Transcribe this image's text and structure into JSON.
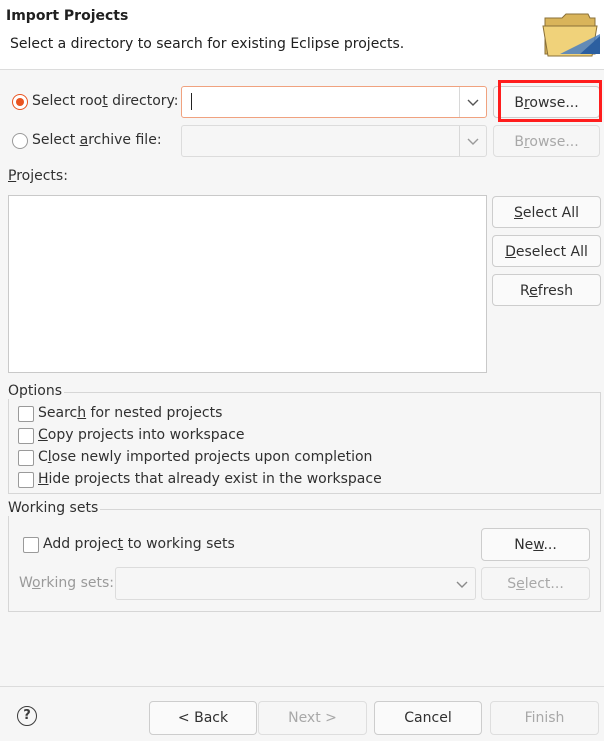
{
  "header": {
    "title": "Import Projects",
    "subtitle": "Select a directory to search for existing Eclipse projects."
  },
  "source": {
    "root_dir_label_pre": "Select roo",
    "root_dir_label_mn": "t",
    "root_dir_label_post": " directory:",
    "root_dir_value": "",
    "archive_label_pre": "Select ",
    "archive_label_mn": "a",
    "archive_label_post": "rchive file:",
    "archive_value": "",
    "browse_pre": "B",
    "browse_mn": "r",
    "browse_post": "owse...",
    "browse2_pre": "B",
    "browse2_mn": "r",
    "browse2_post": "owse..."
  },
  "projects": {
    "label_mn": "P",
    "label_post": "rojects:",
    "items": [],
    "select_all_mn": "S",
    "select_all_post": "elect All",
    "deselect_all_mn": "D",
    "deselect_all_post": "eselect All",
    "refresh_pre": "R",
    "refresh_mn": "e",
    "refresh_post": "fresh"
  },
  "options": {
    "title": "Options",
    "search_nested_pre": "Searc",
    "search_nested_mn": "h",
    "search_nested_post": " for nested projects",
    "copy_pre": "",
    "copy_mn": "C",
    "copy_post": "opy projects into workspace",
    "close_pre": "C",
    "close_mn": "l",
    "close_post": "ose newly imported projects upon completion",
    "hide_pre": "",
    "hide_mn": "H",
    "hide_post": "ide projects that already exist in the workspace"
  },
  "working_sets": {
    "title": "Working sets",
    "add_pre": "Add projec",
    "add_mn": "t",
    "add_post": " to working sets",
    "new_pre": "Ne",
    "new_mn": "w",
    "new_post": "...",
    "sets_label_pre": "W",
    "sets_label_mn": "o",
    "sets_label_post": "rking sets:",
    "sets_value": "",
    "select_pre": "S",
    "select_mn": "e",
    "select_post": "lect..."
  },
  "footer": {
    "help": "?",
    "back": "< Back",
    "next": "Next >",
    "cancel": "Cancel",
    "finish": "Finish"
  },
  "colors": {
    "accent": "#e95420",
    "highlight": "#ff1d1d",
    "focus_border": "#f0a27f"
  }
}
